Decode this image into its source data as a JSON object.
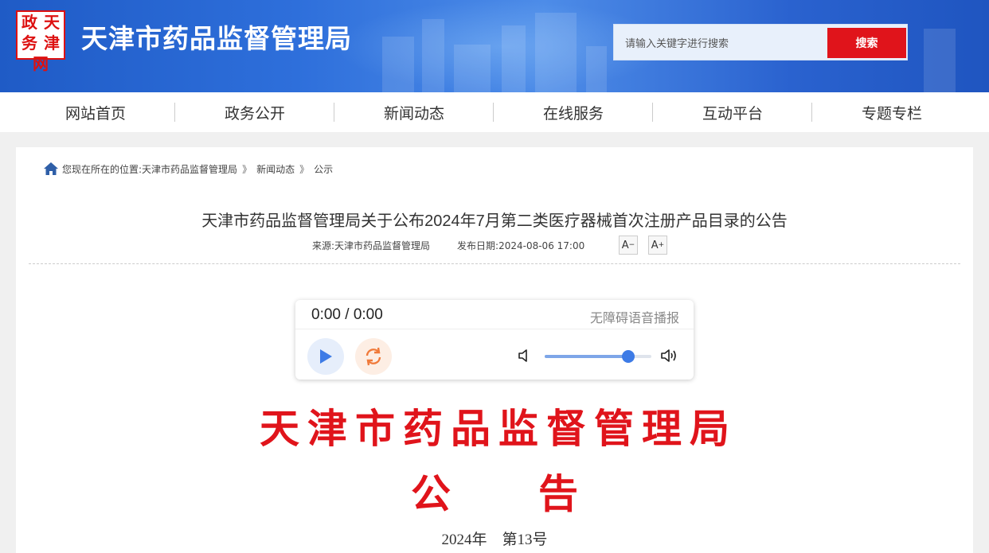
{
  "header": {
    "logo_chars": [
      "政",
      "天",
      "务",
      "津",
      "网"
    ],
    "site_title": "天津市药品监督管理局",
    "search": {
      "placeholder": "请输入关键字进行搜索",
      "button_label": "搜索"
    }
  },
  "nav": {
    "items": [
      {
        "label": "网站首页"
      },
      {
        "label": "政务公开"
      },
      {
        "label": "新闻动态"
      },
      {
        "label": "在线服务"
      },
      {
        "label": "互动平台"
      },
      {
        "label": "专题专栏"
      }
    ]
  },
  "breadcrumb": {
    "prefix": "您现在所在的位置:",
    "items": [
      "天津市药品监督管理局",
      "新闻动态",
      "公示"
    ],
    "separator": "》"
  },
  "article": {
    "title": "天津市药品监督管理局关于公布2024年7月第二类医疗器械首次注册产品目录的公告",
    "source_label": "来源:天津市药品监督管理局",
    "date_label": "发布日期:2024-08-06 17:00",
    "font_decrease": "A",
    "font_increase": "A"
  },
  "player": {
    "time": "0:00 / 0:00",
    "label": "无障碍语音播报",
    "volume_percent": 78
  },
  "document": {
    "org": "天津市药品监督管理局",
    "type": "公告",
    "number": "2024年　第13号"
  },
  "colors": {
    "brand_blue": "#2e6fdb",
    "red": "#e0141b",
    "play_blue": "#3d7be6",
    "loop_orange": "#f07a3a"
  }
}
